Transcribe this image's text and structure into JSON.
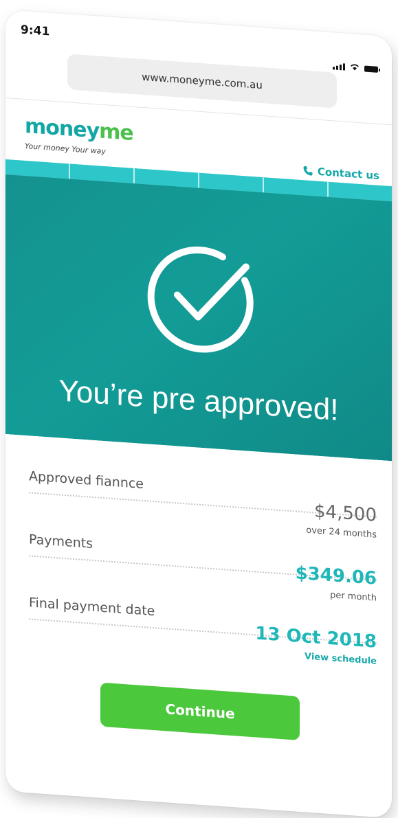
{
  "status_bar": {
    "time": "9:41"
  },
  "browser": {
    "url": "www.moneyme.com.au"
  },
  "header": {
    "logo_part1": "money",
    "logo_part2": "me",
    "tagline": "Your money Your way",
    "contact_label": "Contact us"
  },
  "hero": {
    "title": "You’re pre approved!"
  },
  "details": {
    "finance": {
      "label": "Approved fiannce",
      "value": "$4,500",
      "sub": "over 24 months"
    },
    "payments": {
      "label": "Payments",
      "value": "$349.06",
      "sub": "per month"
    },
    "final_date": {
      "label": "Final payment date",
      "value": "13 Oct 2018",
      "sub": "View schedule"
    }
  },
  "actions": {
    "continue_label": "Continue"
  },
  "colors": {
    "teal": "#14928f",
    "accent_teal": "#20b7b9",
    "green": "#4bc83b"
  }
}
